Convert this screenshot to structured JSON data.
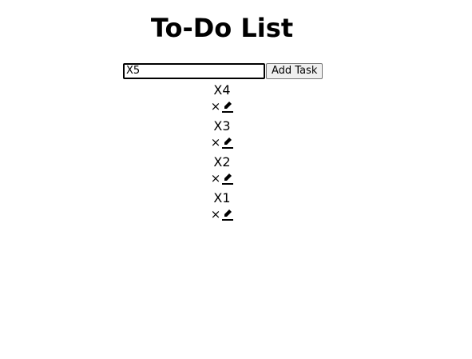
{
  "page": {
    "title": "To-Do List"
  },
  "form": {
    "input_value": "X5",
    "add_label": "Add Task"
  },
  "tasks": [
    {
      "text": "X4",
      "delete_glyph": "×"
    },
    {
      "text": "X3",
      "delete_glyph": "×"
    },
    {
      "text": "X2",
      "delete_glyph": "×"
    },
    {
      "text": "X1",
      "delete_glyph": "×"
    }
  ],
  "icons": {
    "delete": "close-icon",
    "edit": "pencil-icon"
  }
}
